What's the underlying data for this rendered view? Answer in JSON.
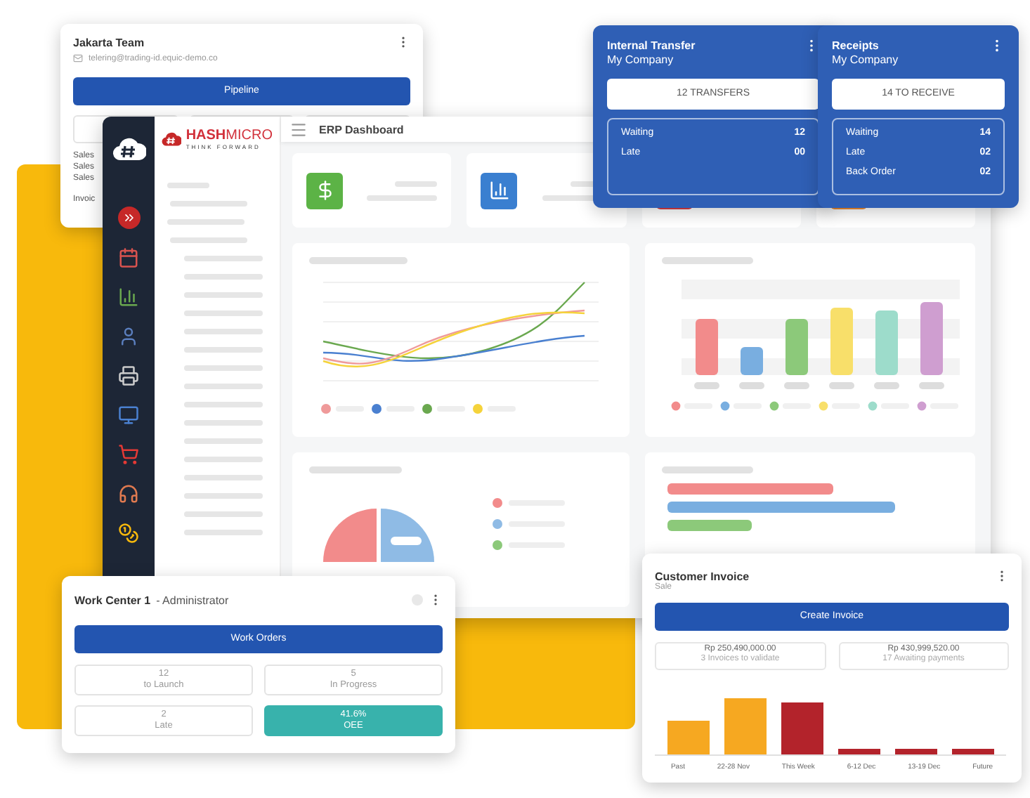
{
  "team_card": {
    "title": "Jakarta Team",
    "email": "telering@trading-id.equic-demo.co",
    "button": "Pipeline",
    "rows": [
      "Sales",
      "Sales",
      "Sales"
    ],
    "footer": "Invoic"
  },
  "dashboard": {
    "title": "ERP Dashboard",
    "brand": "**HASH**MICRO",
    "tagline": "THINK FORWARD"
  },
  "transfer_cards": [
    {
      "title": "Internal Transfer",
      "company": "My Company",
      "button": "12 TRANSFERS",
      "rows": [
        {
          "label": "Waiting",
          "value": "12"
        },
        {
          "label": "Late",
          "value": "00"
        }
      ]
    },
    {
      "title": "Receipts",
      "company": "My Company",
      "button": "14 TO RECEIVE",
      "rows": [
        {
          "label": "Waiting",
          "value": "14"
        },
        {
          "label": "Late",
          "value": "02"
        },
        {
          "label": "Back Order",
          "value": "02"
        }
      ]
    }
  ],
  "work_center": {
    "title": "Work Center 1",
    "role": "- Administrator",
    "button": "Work Orders",
    "tiles": [
      {
        "value": "12",
        "label": "to Launch",
        "kind": "plain"
      },
      {
        "value": "5",
        "label": "In Progress",
        "kind": "plain"
      },
      {
        "value": "2",
        "label": "Late",
        "kind": "plain"
      },
      {
        "value": "41.6%",
        "label": "OEE",
        "kind": "highlight"
      }
    ]
  },
  "invoice": {
    "title": "Customer Invoice",
    "subtitle": "Sale",
    "button": "Create Invoice",
    "stats": [
      {
        "amount": "Rp 250,490,000.00",
        "label": "3 Invoices to validate"
      },
      {
        "amount": "Rp 430,999,520.00",
        "label": "17 Awaiting payments"
      }
    ],
    "categories": [
      "Past",
      "22-28 Nov",
      "This Week",
      "6-12 Dec",
      "13-19 Dec",
      "Future"
    ]
  }
}
